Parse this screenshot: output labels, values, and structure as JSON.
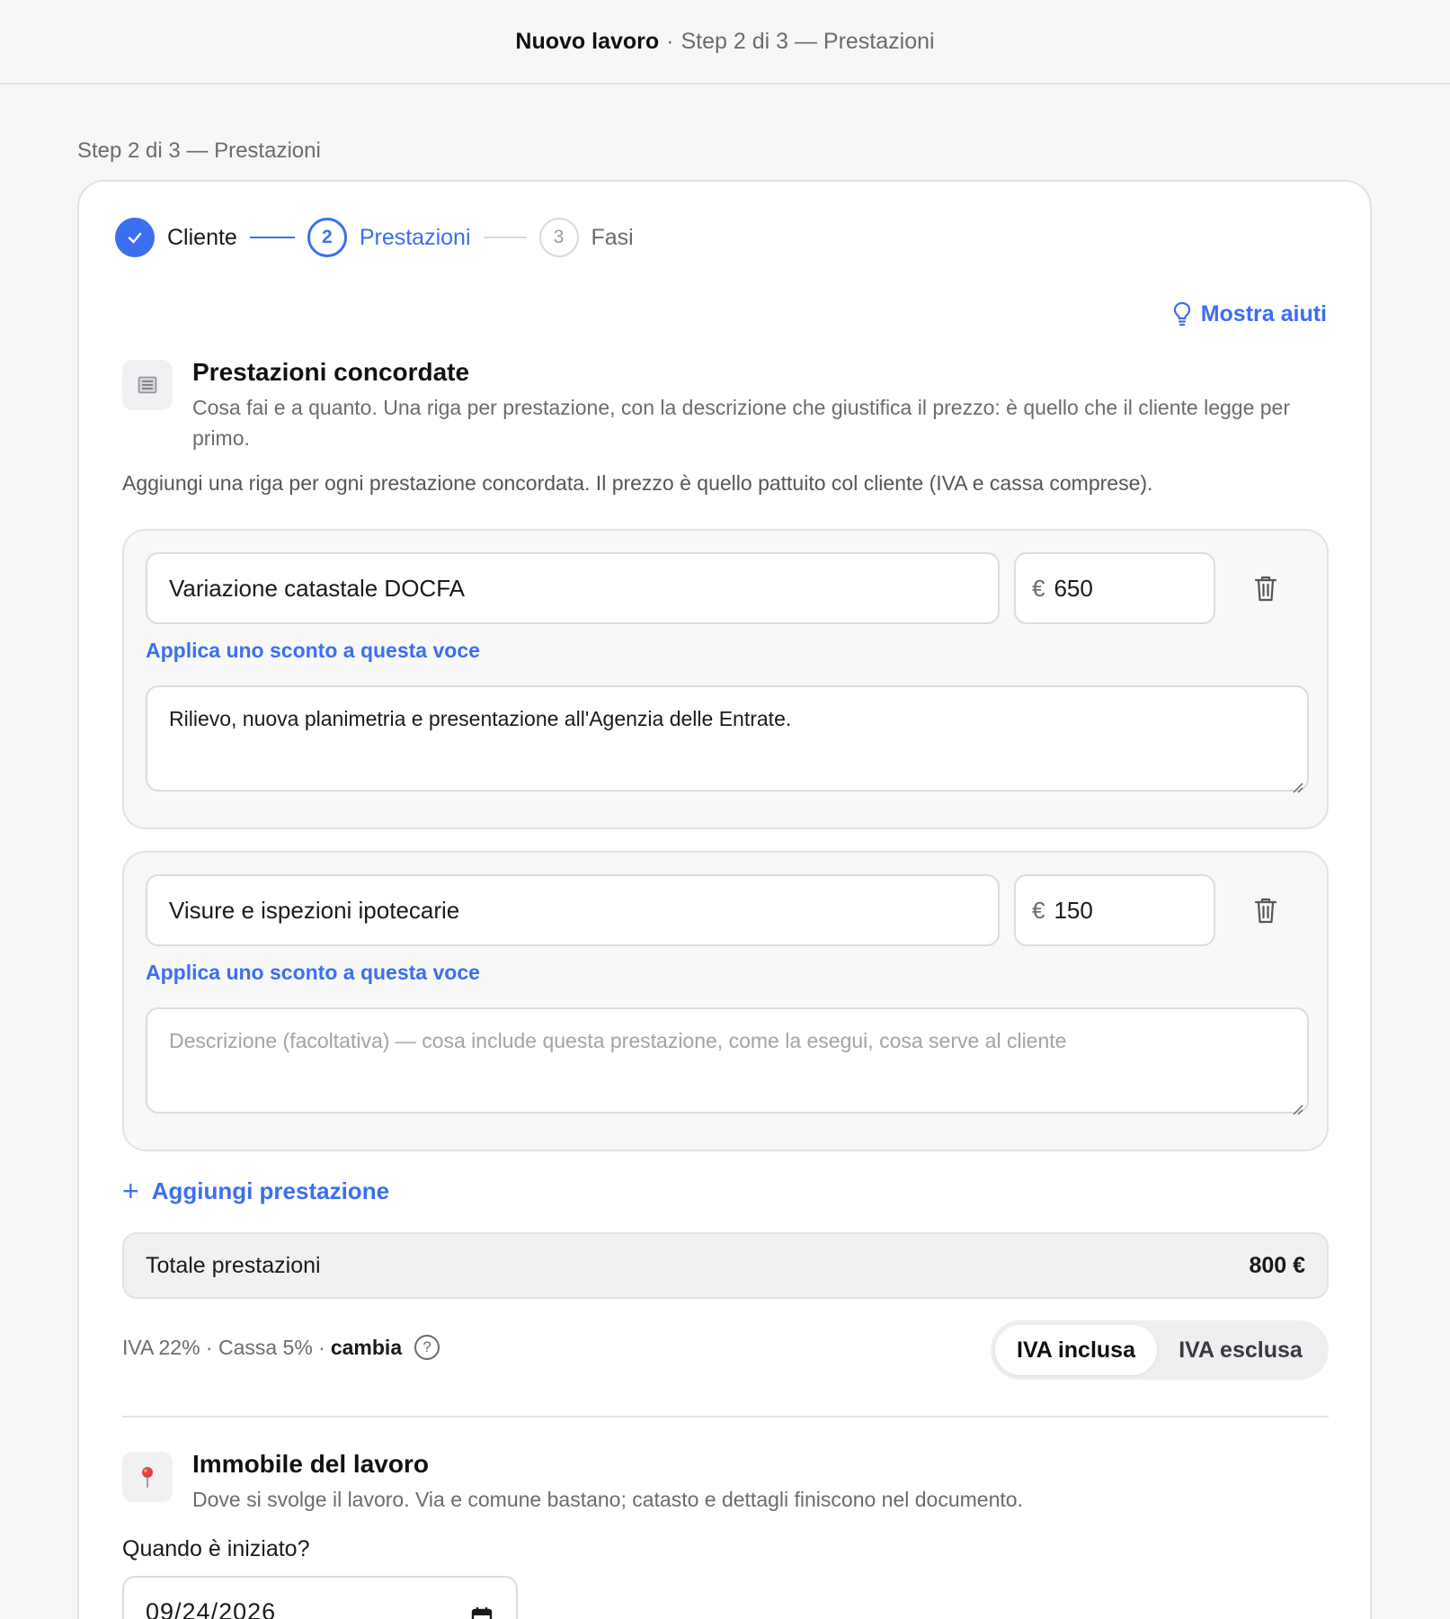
{
  "header": {
    "app_title": "Nuovo lavoro",
    "separator": "·",
    "step_text": "Step 2 di 3 — Prestazioni"
  },
  "step_caption": "Step 2 di 3 — Prestazioni",
  "stepper": {
    "steps": [
      {
        "number": "",
        "label": "Cliente",
        "state": "done"
      },
      {
        "number": "2",
        "label": "Prestazioni",
        "state": "active"
      },
      {
        "number": "3",
        "label": "Fasi",
        "state": "todo"
      }
    ]
  },
  "help_link": "Mostra aiuti",
  "section_services": {
    "icon": "document-icon",
    "title": "Prestazioni concordate",
    "description": "Cosa fai e a quanto. Una riga per prestazione, con la descrizione che giustifica il prezzo: è quello che il cliente legge per primo."
  },
  "intro_text": "Aggiungi una riga per ogni prestazione concordata. Il prezzo è quello pattuito col cliente (IVA e cassa comprese).",
  "rows": [
    {
      "name": "Variazione catastale DOCFA",
      "currency": "€",
      "price": "650",
      "discount_link": "Applica uno sconto a questa voce",
      "description": "Rilievo, nuova planimetria e presentazione all'Agenzia delle Entrate.",
      "description_placeholder": ""
    },
    {
      "name": "Visure e ispezioni ipotecarie",
      "currency": "€",
      "price": "150",
      "discount_link": "Applica uno sconto a questa voce",
      "description": "",
      "description_placeholder": "Descrizione (facoltativa) — cosa include questa prestazione, come la esegui, cosa serve al cliente"
    }
  ],
  "add_row": {
    "icon": "+",
    "label": "Aggiungi prestazione"
  },
  "total": {
    "label": "Totale prestazioni",
    "value": "800 €"
  },
  "tax": {
    "rates": "IVA 22% · Cassa 5% ·",
    "change_link": "cambia",
    "help_icon": "?"
  },
  "vat_toggle": {
    "options": [
      "IVA inclusa",
      "IVA esclusa"
    ],
    "selected": "IVA inclusa"
  },
  "section_property": {
    "icon": "pin-icon",
    "title": "Immobile del lavoro",
    "description": "Dove si svolge il lavoro. Via e comune bastano; catasto e dettagli finiscono nel documento."
  },
  "start_question": "Quando è iniziato?",
  "start_date": "09/24/2026",
  "colors": {
    "accent": "#3b6ff0",
    "pin": "#e0453a"
  }
}
